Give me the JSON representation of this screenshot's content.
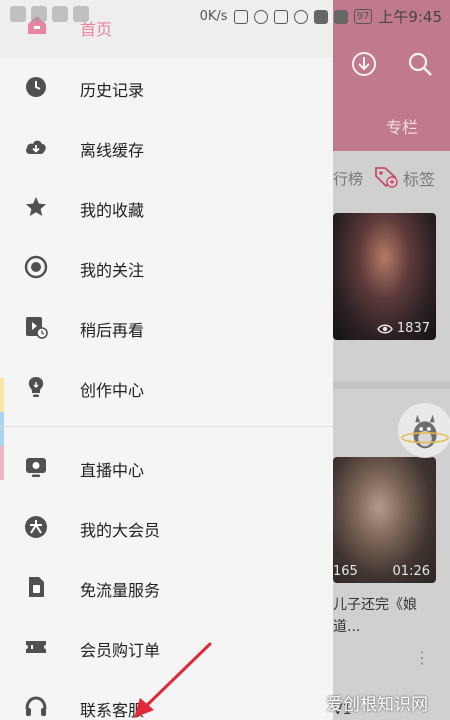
{
  "status_bar": {
    "speed": "0K/s",
    "battery": "97",
    "time": "上午9:45"
  },
  "background": {
    "tab_column": "专栏",
    "tab_rank": "行榜",
    "tab_tags": "标签",
    "video1_views": "1837",
    "video2_count": "165",
    "video2_duration": "01:26",
    "video2_title": "儿子还完《娘道...",
    "uploader_partial": "V1"
  },
  "drawer": {
    "home_label": "首页",
    "items": [
      {
        "label": "历史记录",
        "icon": "clock-icon"
      },
      {
        "label": "离线缓存",
        "icon": "cloud-download-icon"
      },
      {
        "label": "我的收藏",
        "icon": "star-icon"
      },
      {
        "label": "我的关注",
        "icon": "follow-icon"
      },
      {
        "label": "稍后再看",
        "icon": "watch-later-icon"
      },
      {
        "label": "创作中心",
        "icon": "lightbulb-icon"
      },
      {
        "label": "直播中心",
        "icon": "live-tv-icon"
      },
      {
        "label": "我的大会员",
        "icon": "vip-icon"
      },
      {
        "label": "免流量服务",
        "icon": "sim-card-icon"
      },
      {
        "label": "会员购订单",
        "icon": "ticket-icon"
      },
      {
        "label": "联系客服",
        "icon": "headset-icon"
      }
    ],
    "strip_colors": [
      "#f7e6a8",
      "#a9d6ee",
      "#f1b4c4"
    ]
  },
  "watermark": "爱创根知识网",
  "colors": {
    "accent_pink": "#e9859e",
    "header_bg": "#c07a8b",
    "annotation_red": "#e0293a"
  }
}
